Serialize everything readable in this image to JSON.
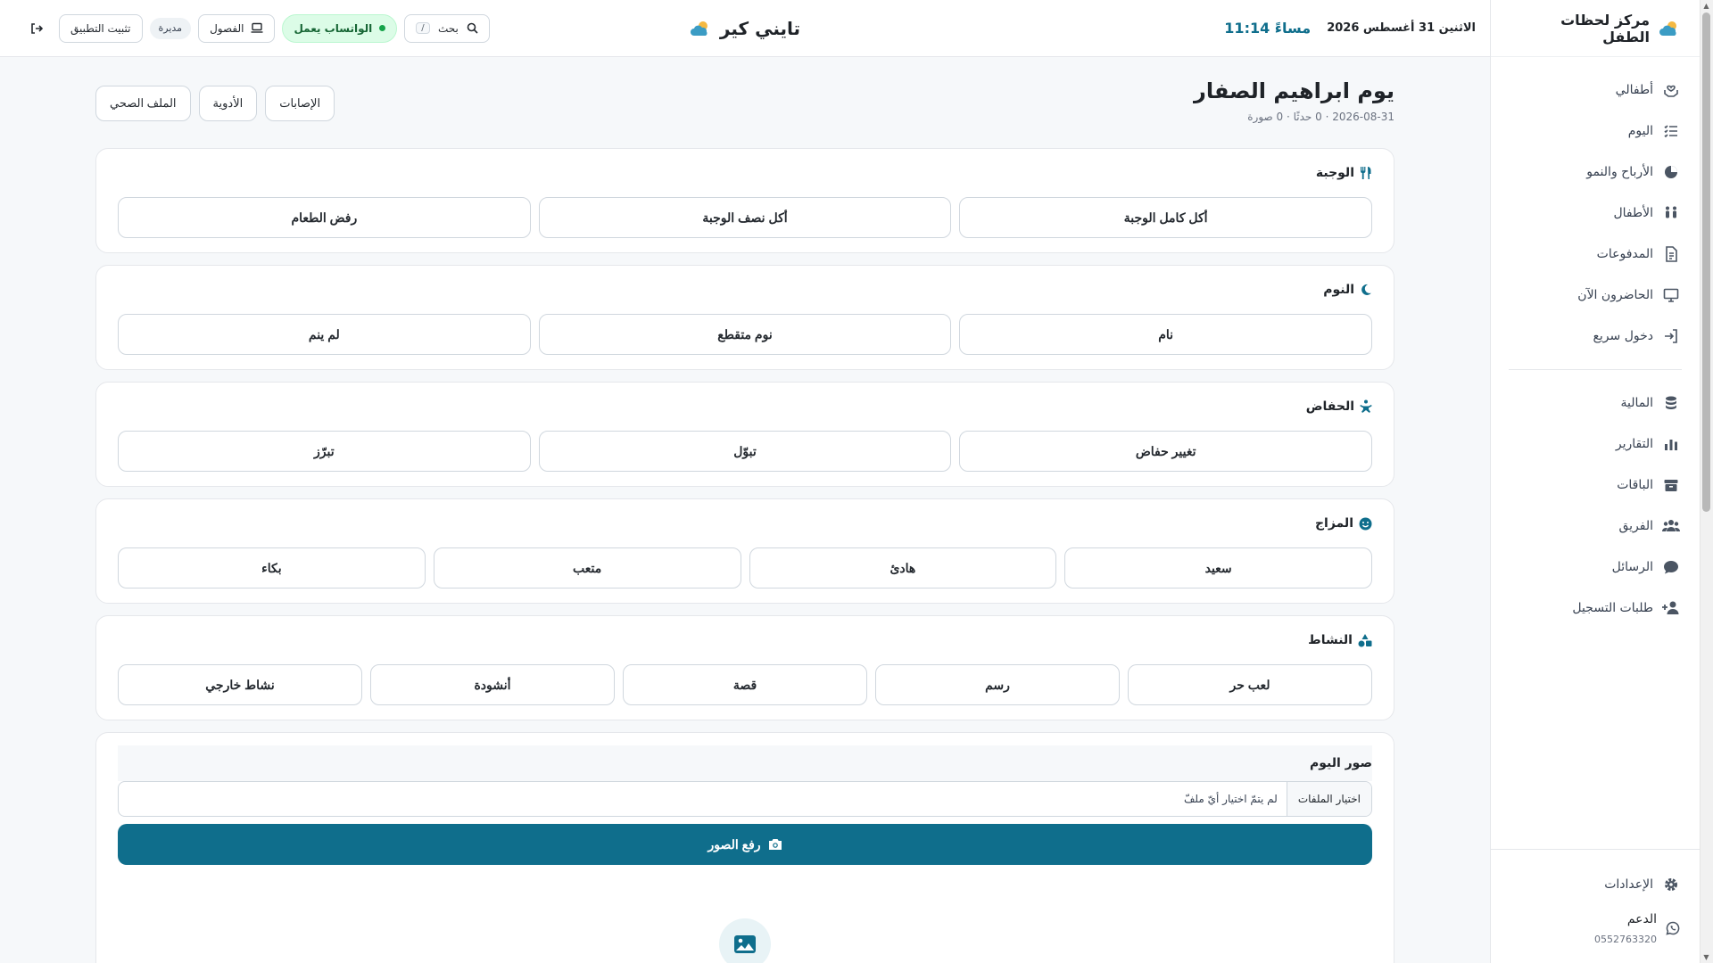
{
  "sidebar": {
    "brand": "مركز لحظات الطفل",
    "items": [
      {
        "label": "أطفالي",
        "icon": "hands-heart-icon"
      },
      {
        "label": "اليوم",
        "icon": "checklist-icon"
      },
      {
        "label": "الأرباح والنمو",
        "icon": "chart-pie-icon"
      },
      {
        "label": "الأطفال",
        "icon": "children-icon"
      },
      {
        "label": "المدفوعات",
        "icon": "receipt-icon"
      },
      {
        "label": "الحاضرون الآن",
        "icon": "monitor-icon"
      },
      {
        "label": "دخول سريع",
        "icon": "sign-in-icon"
      }
    ],
    "items2": [
      {
        "label": "المالية",
        "icon": "coins-icon"
      },
      {
        "label": "التقارير",
        "icon": "bar-chart-icon"
      },
      {
        "label": "الباقات",
        "icon": "box-icon"
      },
      {
        "label": "الفريق",
        "icon": "team-icon"
      },
      {
        "label": "الرسائل",
        "icon": "chat-icon"
      },
      {
        "label": "طلبات التسجيل",
        "icon": "user-plus-icon"
      }
    ],
    "settings": "الإعدادات",
    "support": "الدعم",
    "support_phone": "0552763320"
  },
  "topbar": {
    "date": "الاثنين 31 أغسطس 2026",
    "time": "مساءً 11:14",
    "app_name": "تايني كير",
    "search_label": "بحث",
    "search_kbd": "/",
    "whatsapp": "الواتساب يعمل",
    "classes": "الفصول",
    "role": "مديرة",
    "install": "تثبيت التطبيق"
  },
  "page": {
    "title": "يوم ابراهيم الصفار",
    "subtitle": "2026-08-31 · 0 حدثًا · 0 صورة",
    "actions": [
      "الإصابات",
      "الأدوية",
      "الملف الصحي"
    ]
  },
  "sections": {
    "meal": {
      "title": "الوجبة",
      "options": [
        "أكل كامل الوجبة",
        "أكل نصف الوجبة",
        "رفض الطعام"
      ]
    },
    "sleep": {
      "title": "النوم",
      "options": [
        "نام",
        "نوم متقطع",
        "لم ينم"
      ]
    },
    "diaper": {
      "title": "الحفاض",
      "options": [
        "تغيير حفاض",
        "تبوّل",
        "تبرّز"
      ]
    },
    "mood": {
      "title": "المزاج",
      "options": [
        "سعيد",
        "هادئ",
        "متعب",
        "بكاء"
      ]
    },
    "activity": {
      "title": "النشاط",
      "options": [
        "لعب حر",
        "رسم",
        "قصة",
        "أنشودة",
        "نشاط خارجي"
      ]
    }
  },
  "photos": {
    "title": "صور اليوم",
    "file_button": "اختيار الملفات",
    "file_status": "لم يتمّ اختيار أيّ ملفّ",
    "upload": "رفع الصور"
  },
  "colors": {
    "accent": "#0f6e8c",
    "whatsapp_bg": "#dcfce7",
    "whatsapp_dot": "#16a34a"
  }
}
